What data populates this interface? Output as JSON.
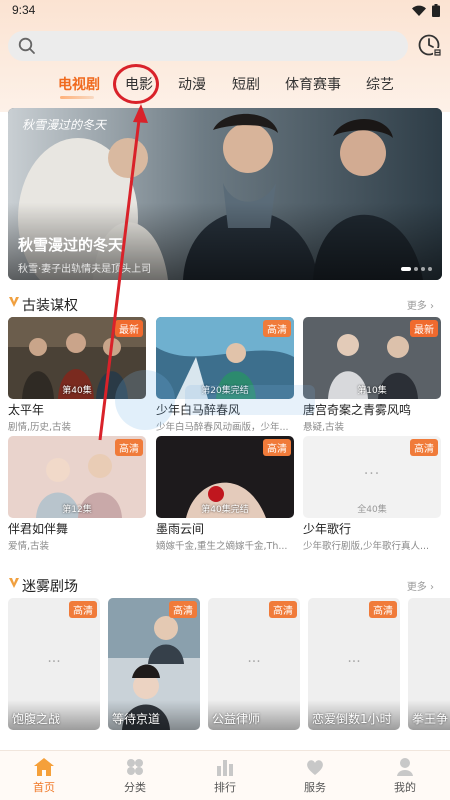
{
  "status_bar": {
    "time": "9:34"
  },
  "search": {
    "placeholder": ""
  },
  "history_icon": "clock-history-icon",
  "tabs": [
    {
      "label": "电视剧",
      "active": true
    },
    {
      "label": "电影",
      "active": false
    },
    {
      "label": "动漫",
      "active": false
    },
    {
      "label": "短剧",
      "active": false
    },
    {
      "label": "体育赛事",
      "active": false
    },
    {
      "label": "综艺",
      "active": false
    }
  ],
  "banner": {
    "title": "秋雪漫过的冬天",
    "subtitle": "秋雪·妻子出轨情夫是顶头上司",
    "calligraphy": "秋雪漫过的冬天",
    "dots": 4,
    "active_dot": 0
  },
  "section1": {
    "title": "古装谋权",
    "more": "更多",
    "cards": [
      {
        "title": "太平年",
        "tags": "剧情,历史,古装",
        "badge": "最新",
        "episode": "第40集"
      },
      {
        "title": "少年白马醉春风",
        "tags": "少年白马醉春风动画版，少年...",
        "badge": "高清",
        "episode": "第20集完结"
      },
      {
        "title": "唐宫奇案之青雾风鸣",
        "tags": "悬疑,古装",
        "badge": "最新",
        "episode": "第10集"
      },
      {
        "title": "伴君如伴舞",
        "tags": "爱情,古装",
        "badge": "高清",
        "episode": "第12集"
      },
      {
        "title": "墨雨云间",
        "tags": "嫡嫁千金,重生之嫡嫁千金,Th...",
        "badge": "高清",
        "episode": "第40集完结"
      },
      {
        "title": "少年歌行",
        "tags": "少年歌行剧版,少年歌行真人...",
        "badge": "高清",
        "episode": "全40集"
      }
    ]
  },
  "section2": {
    "title": "迷雾剧场",
    "more": "更多",
    "posters": [
      {
        "title": "饱腹之战",
        "badge": "高清"
      },
      {
        "title": "等待京道",
        "badge": "高清"
      },
      {
        "title": "公益律师",
        "badge": "高清"
      },
      {
        "title": "恋爱倒数1小时",
        "badge": "高清"
      },
      {
        "title": "拳王争",
        "badge": ""
      }
    ]
  },
  "bottom_nav": [
    {
      "label": "首页",
      "icon": "home-icon",
      "active": true
    },
    {
      "label": "分类",
      "icon": "category-icon",
      "active": false
    },
    {
      "label": "排行",
      "icon": "ranking-icon",
      "active": false
    },
    {
      "label": "服务",
      "icon": "heart-service-icon",
      "active": false
    },
    {
      "label": "我的",
      "icon": "profile-icon",
      "active": false
    }
  ],
  "colors": {
    "accent": "#f06a1e",
    "annotation": "#d9222a"
  }
}
